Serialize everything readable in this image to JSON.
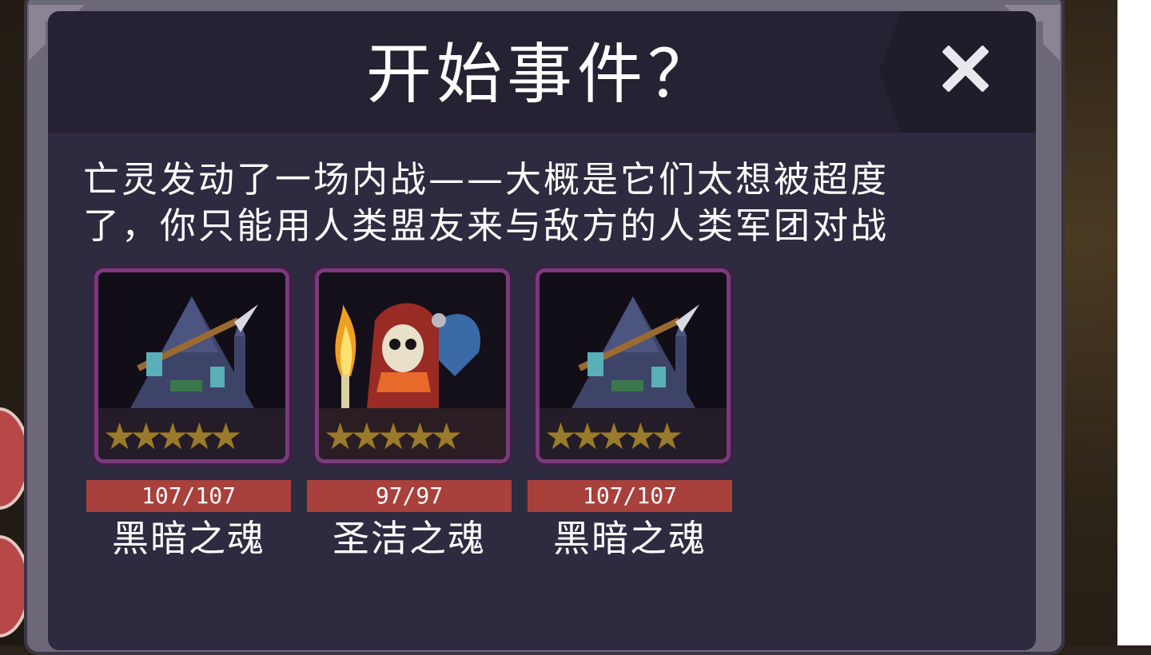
{
  "dialog": {
    "title": "开始事件？",
    "close_icon": "close-icon",
    "description": "亡灵发动了一场内战——大概是它们太想被超度\n了，你只能用人类盟友来与敌方的人类军团对战"
  },
  "cards": [
    {
      "hp": "107/107",
      "name": "黑暗之魂",
      "portrait": "scythe-undead-portrait",
      "stars": 5
    },
    {
      "hp": "97/97",
      "name": "圣洁之魂",
      "portrait": "hooded-skeleton-torch-portrait",
      "stars": 5
    },
    {
      "hp": "107/107",
      "name": "黑暗之魂",
      "portrait": "scythe-undead-portrait",
      "stars": 5
    }
  ],
  "colors": {
    "panel_bg": "#2e2a3f",
    "header_bg": "#262233",
    "frame": "#6d6878",
    "hp_bar": "#a8403c",
    "card_border": "#7a3a7c",
    "star": "#9a7a2c"
  }
}
